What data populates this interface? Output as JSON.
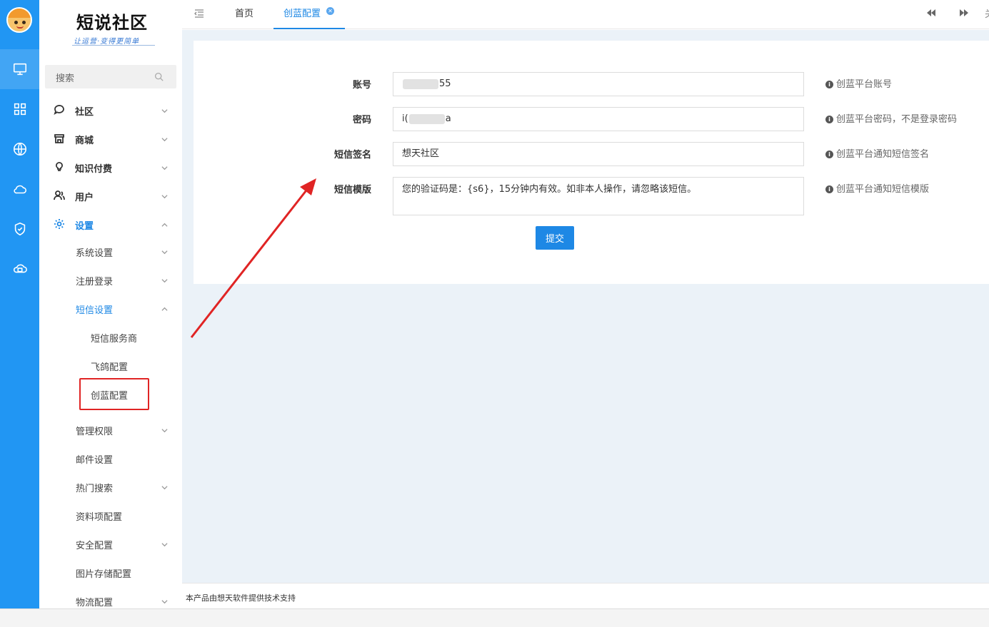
{
  "colors": {
    "rail": "#2196f3",
    "accent": "#1e88e5",
    "main_bg": "#ebf2f8",
    "annotation": "#e02424"
  },
  "logo": {
    "title": "短说社区",
    "subtitle": "让运营·变得更简单"
  },
  "search": {
    "placeholder": "搜索",
    "icon": "search-icon"
  },
  "rail_icons": [
    "monitor-icon",
    "grid-icon",
    "globe-icon",
    "cloud-icon",
    "shield-check-icon",
    "cloud-storage-icon"
  ],
  "sidebar": {
    "menus": [
      {
        "label": "社区",
        "icon": "chat-icon"
      },
      {
        "label": "商城",
        "icon": "store-icon"
      },
      {
        "label": "知识付费",
        "icon": "bulb-icon"
      },
      {
        "label": "用户",
        "icon": "users-icon"
      },
      {
        "label": "设置",
        "icon": "gear-icon"
      }
    ],
    "settings_children": [
      {
        "label": "系统设置"
      },
      {
        "label": "注册登录"
      },
      {
        "label": "短信设置"
      },
      {
        "label": "管理权限"
      },
      {
        "label": "邮件设置"
      },
      {
        "label": "热门搜索"
      },
      {
        "label": "资料项配置"
      },
      {
        "label": "安全配置"
      },
      {
        "label": "图片存储配置"
      },
      {
        "label": "物流配置"
      }
    ],
    "sms_children": [
      {
        "label": "短信服务商"
      },
      {
        "label": "飞鸽配置"
      },
      {
        "label": "创蓝配置"
      }
    ]
  },
  "tabs": [
    {
      "label": "首页"
    },
    {
      "label": "创蓝配置"
    }
  ],
  "topbar_cut_text": "关",
  "form": {
    "fields": [
      {
        "label": "账号",
        "value_prefix": "",
        "value_suffix": "55",
        "hint": "创蓝平台账号"
      },
      {
        "label": "密码",
        "value_prefix": "i(",
        "value_suffix": "a",
        "hint": "创蓝平台密码，不是登录密码"
      },
      {
        "label": "短信签名",
        "value": "想天社区",
        "hint": "创蓝平台通知短信签名"
      },
      {
        "label": "短信模版",
        "value": "您的验证码是：{s6}，15分钟内有效。如非本人操作，请忽略该短信。",
        "hint": "创蓝平台通知短信模版"
      }
    ],
    "submit_label": "提交"
  },
  "footer": {
    "text": "本产品由想天软件提供技术支持"
  }
}
